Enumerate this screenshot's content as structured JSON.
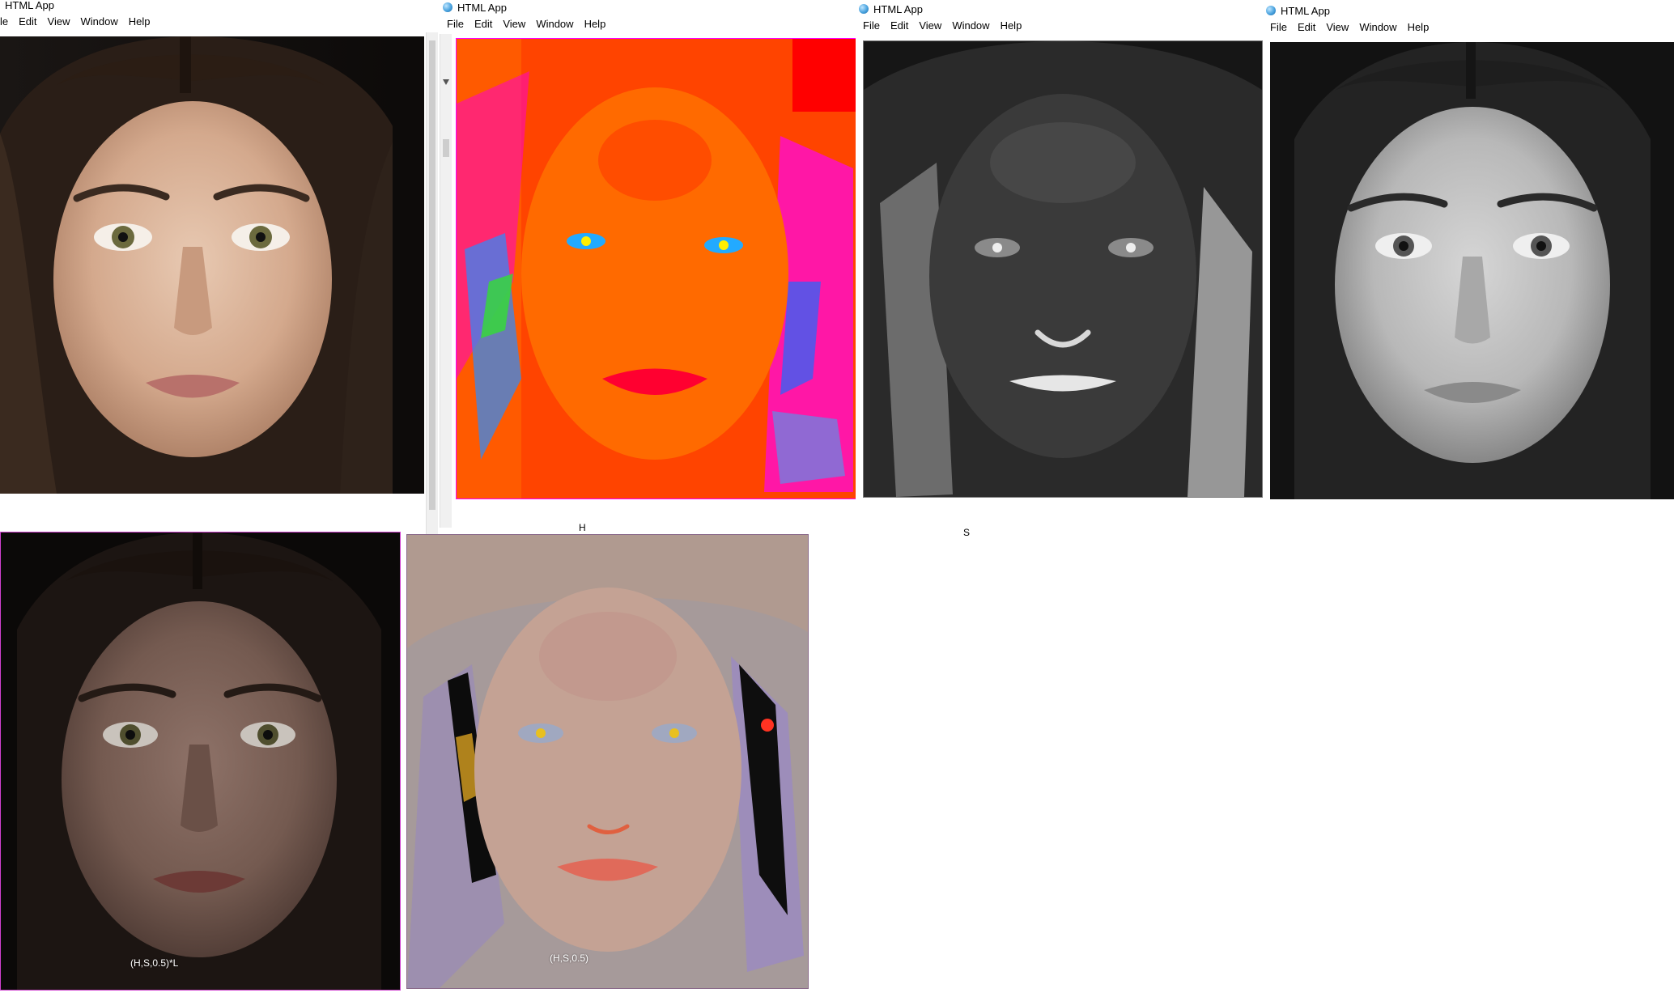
{
  "colors": {
    "titlebar_bg": "#ffffff",
    "page_bg": "#ffffff",
    "dark_bg": "#111111",
    "hue_accent": "#ff6a00",
    "hue_magenta": "#ff00ff"
  },
  "windows": [
    {
      "title": "HTML App",
      "menu": [
        "le",
        "Edit",
        "View",
        "Window",
        "Help"
      ],
      "panel": "original-photo"
    },
    {
      "title": "HTML App",
      "menu": [
        "File",
        "Edit",
        "View",
        "Window",
        "Help"
      ],
      "panel": "hue-channel",
      "caption": "H"
    },
    {
      "title": "HTML App",
      "menu": [
        "File",
        "Edit",
        "View",
        "Window",
        "Help"
      ],
      "panel": "saturation-channel",
      "caption": "S"
    },
    {
      "title": "HTML App",
      "menu": [
        "File",
        "Edit",
        "View",
        "Window",
        "Help"
      ],
      "panel": "lightness-channel"
    }
  ],
  "bottom_panels": [
    {
      "panel": "hs-times-l",
      "caption": "(H,S,0.5)*L"
    },
    {
      "panel": "hs-half",
      "caption": "(H,S,0.5)"
    }
  ],
  "icons": {
    "app": "app-globe-icon",
    "scroll_down": "scroll-down-arrow-icon"
  }
}
